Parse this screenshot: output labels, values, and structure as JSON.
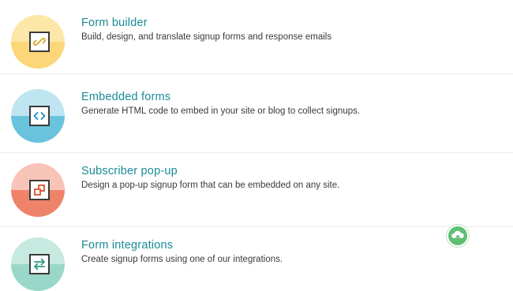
{
  "items": [
    {
      "title": "Form builder",
      "description": "Build, design, and translate signup forms and response emails",
      "icon": "link-icon",
      "colors": {
        "top": "#fde7a8",
        "bottom": "#fbd77a",
        "stroke": "#d9a62a"
      }
    },
    {
      "title": "Embedded forms",
      "description": "Generate HTML code to embed in your site or blog to collect signups.",
      "icon": "code-icon",
      "colors": {
        "top": "#bfe5f0",
        "bottom": "#69c3dd",
        "stroke": "#1a8fb5"
      }
    },
    {
      "title": "Subscriber pop-up",
      "description": "Design a pop-up signup form that can be embedded on any site.",
      "icon": "popup-icon",
      "colors": {
        "top": "#f9c4b8",
        "bottom": "#ef8369",
        "stroke": "#d8532f"
      }
    },
    {
      "title": "Form integrations",
      "description": "Create signup forms using one of our integrations.",
      "icon": "swap-arrows-icon",
      "colors": {
        "top": "#c6e9e0",
        "bottom": "#99d8c8",
        "stroke": "#2f9a82"
      }
    }
  ],
  "fab": {
    "icon": "cloud-upload-icon",
    "color": "#5fbf73"
  }
}
